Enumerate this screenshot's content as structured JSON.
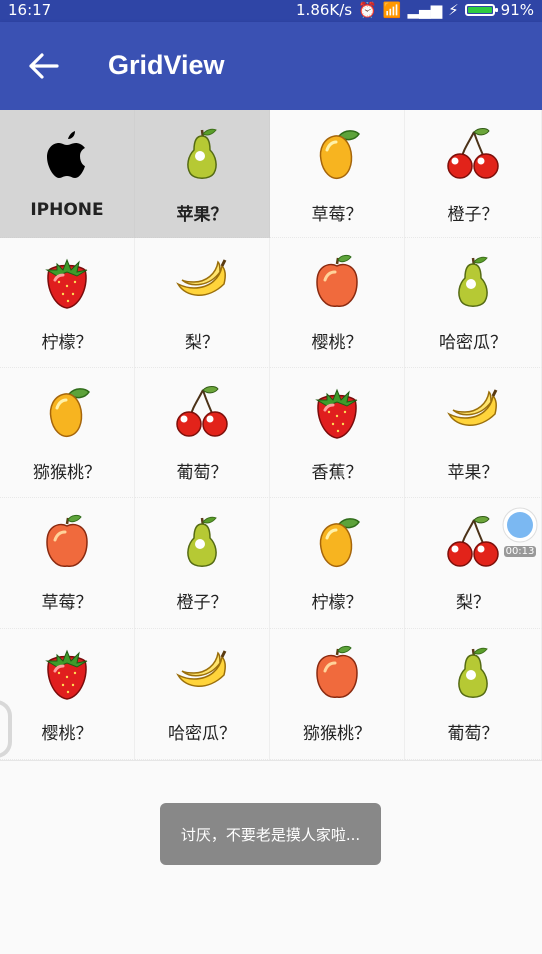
{
  "status_bar": {
    "time": "16:17",
    "network_speed": "1.86K/s",
    "battery": "91%"
  },
  "toolbar": {
    "title": "GridView"
  },
  "grid_items": [
    {
      "label": "IPHONE",
      "icon": "apple-logo-icon",
      "selected": true
    },
    {
      "label": "苹果？",
      "icon": "pear-icon",
      "selected": true
    },
    {
      "label": "草莓？",
      "icon": "mango-icon"
    },
    {
      "label": "橙子？",
      "icon": "cherry-icon"
    },
    {
      "label": "柠檬？",
      "icon": "strawberry-icon"
    },
    {
      "label": "梨？",
      "icon": "banana-icon"
    },
    {
      "label": "樱桃？",
      "icon": "apple-icon"
    },
    {
      "label": "哈密瓜？",
      "icon": "pear-icon"
    },
    {
      "label": "猕猴桃？",
      "icon": "mango-icon"
    },
    {
      "label": "葡萄？",
      "icon": "cherry-icon"
    },
    {
      "label": "香蕉？",
      "icon": "strawberry-icon"
    },
    {
      "label": "苹果？",
      "icon": "banana-icon"
    },
    {
      "label": "草莓？",
      "icon": "apple-icon"
    },
    {
      "label": "橙子？",
      "icon": "pear-icon"
    },
    {
      "label": "柠檬？",
      "icon": "mango-icon"
    },
    {
      "label": "梨？",
      "icon": "cherry-icon"
    },
    {
      "label": "樱桃？",
      "icon": "strawberry-icon"
    },
    {
      "label": "哈密瓜？",
      "icon": "banana-icon"
    },
    {
      "label": "猕猴桃？",
      "icon": "apple-icon"
    },
    {
      "label": "葡萄？",
      "icon": "pear-icon"
    }
  ],
  "toast": {
    "text": "讨厌，不要老是摸人家啦..."
  },
  "floating_bubble": {
    "time": "00:13"
  },
  "colors": {
    "toolbar": "#3a51b3",
    "status_bar": "#2f45a6",
    "selected_cell": "#d5d5d5"
  }
}
